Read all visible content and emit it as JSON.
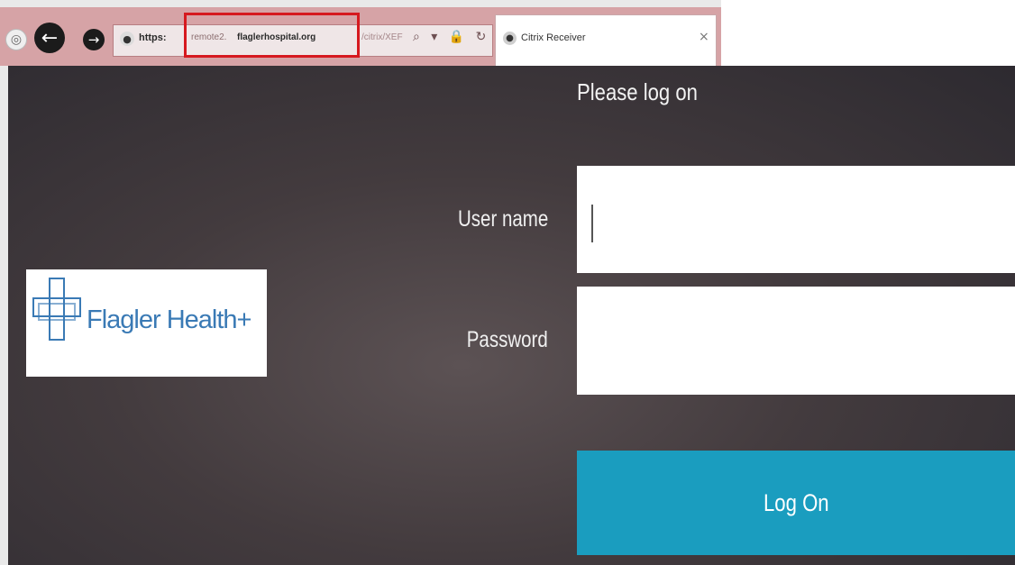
{
  "browser": {
    "url": {
      "scheme": "https:",
      "prefix": "remote2.",
      "domain": "flaglerhospital.org",
      "rest": "/citrix/XEF",
      "highlight_color": "#d6191f"
    },
    "address_icons": [
      "search-icon",
      "dropdown-icon",
      "lock-icon",
      "refresh-icon"
    ],
    "address_glyphs": "⌕ ▾ 🔒 ↻",
    "tab": {
      "title": "Citrix Receiver",
      "close_glyph": "×"
    }
  },
  "login": {
    "heading": "Please log on",
    "username_label": "User name",
    "password_label": "Password",
    "username_value": "",
    "password_value": "",
    "submit_label": "Log On",
    "submit_color": "#1a9dbf"
  },
  "logo": {
    "text": "Flagler Health+",
    "color": "#3a7ab5"
  }
}
